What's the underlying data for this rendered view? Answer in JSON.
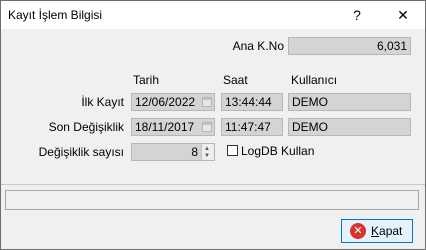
{
  "window": {
    "title": "Kayıt İşlem Bilgisi",
    "help_glyph": "?",
    "close_glyph": "✕"
  },
  "ana_kno": {
    "label": "Ana K.No",
    "value": "6,031"
  },
  "columns": {
    "tarih": "Tarih",
    "saat": "Saat",
    "kullanici": "Kullanıcı"
  },
  "rows": [
    {
      "label": "İlk Kayıt",
      "date": "12/06/2022",
      "time": "13:44:44",
      "user": "DEMO"
    },
    {
      "label": "Son Değişiklik",
      "date": "18/11/2017",
      "time": "11:47:47",
      "user": "DEMO"
    }
  ],
  "degisiklik": {
    "label": "Değişiklik sayısı",
    "value": "8"
  },
  "logdb": {
    "label": "LogDB Kullan",
    "checked": false
  },
  "status_text": "",
  "close_button": {
    "label_first": "K",
    "label_rest": "apat",
    "icon": "close-circle-icon"
  }
}
